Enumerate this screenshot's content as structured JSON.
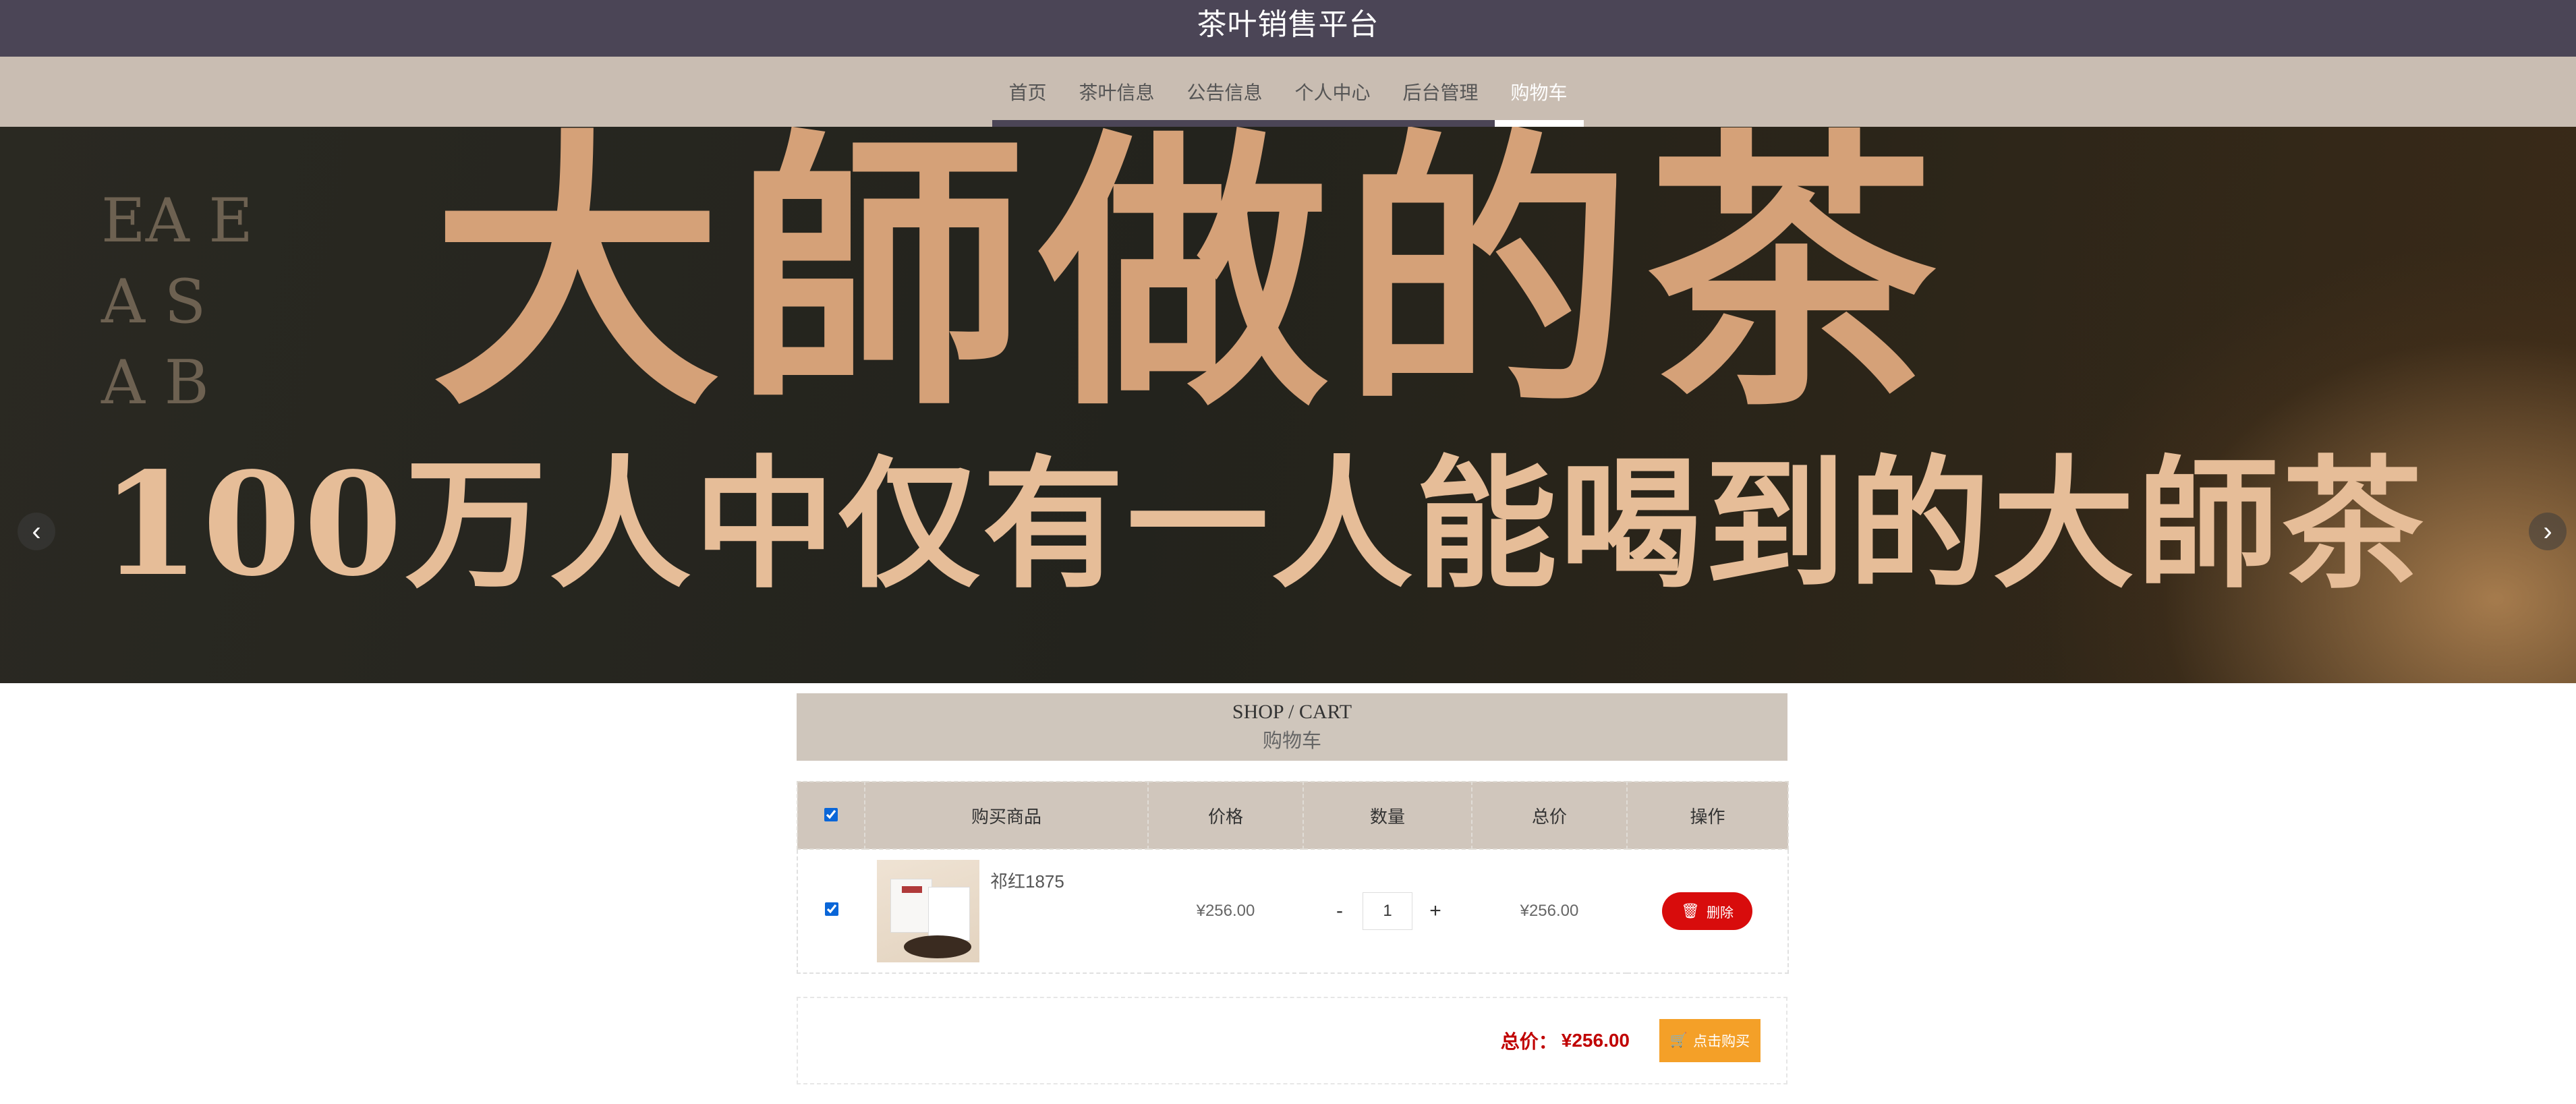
{
  "header": {
    "title": "茶叶销售平台"
  },
  "nav": {
    "items": [
      {
        "label": "首页"
      },
      {
        "label": "茶叶信息"
      },
      {
        "label": "公告信息"
      },
      {
        "label": "个人中心"
      },
      {
        "label": "后台管理"
      },
      {
        "label": "购物车"
      }
    ],
    "active_index": 5
  },
  "banner": {
    "headline": "大師做的茶",
    "subline": "100万人中仅有一人能喝到的大師茶",
    "vertical_text": "EA E A S A B",
    "prev_icon": "chevron-left-icon",
    "next_icon": "chevron-right-icon",
    "slide_count": 3,
    "active_slide": 1
  },
  "section": {
    "title_en": "SHOP / CART",
    "title_zh": "购物车"
  },
  "cart": {
    "columns": [
      "购买商品",
      "价格",
      "数量",
      "总价",
      "操作"
    ],
    "select_all_checked": true,
    "items": [
      {
        "name": "祁红1875",
        "price": "¥256.00",
        "quantity": "1",
        "total": "¥256.00",
        "delete_label": "删除",
        "checked": true
      }
    ],
    "qty_minus": "-",
    "qty_plus": "+"
  },
  "summary": {
    "label": "总价：",
    "amount": "¥256.00",
    "buy_label": "点击购买"
  },
  "colors": {
    "topbar": "#4b4556",
    "navbar": "#c9bdb2",
    "delete": "#d80c0c",
    "buy": "#f4a028",
    "price_total": "#c00000"
  }
}
